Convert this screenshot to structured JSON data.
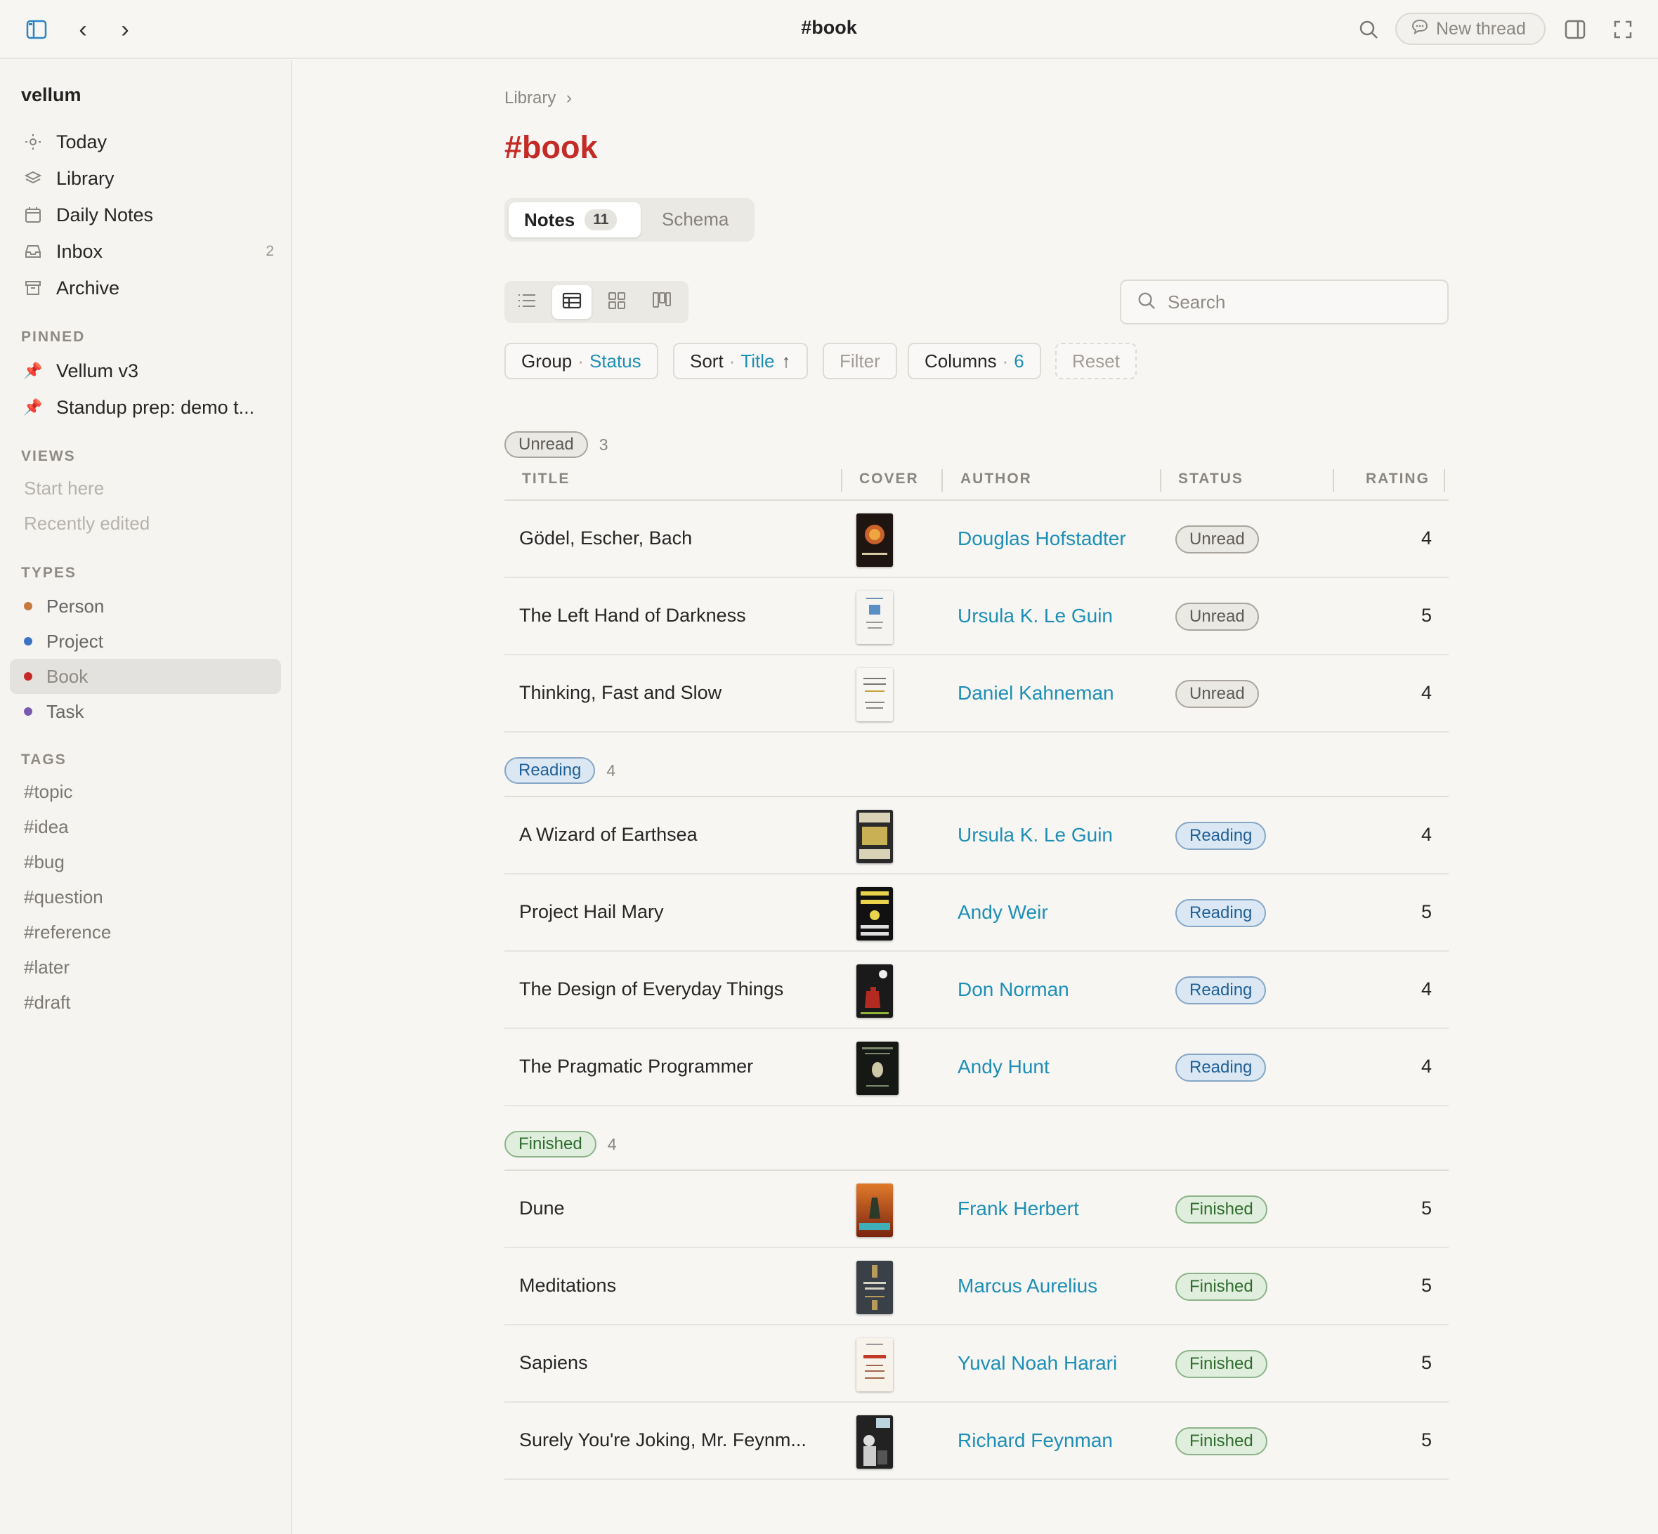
{
  "topbar": {
    "title": "#book",
    "new_thread_label": "New thread"
  },
  "sidebar": {
    "workspace": "vellum",
    "nav": [
      {
        "label": "Today",
        "icon": "sun-icon",
        "count": ""
      },
      {
        "label": "Library",
        "icon": "layers-icon",
        "count": ""
      },
      {
        "label": "Daily Notes",
        "icon": "calendar-icon",
        "count": ""
      },
      {
        "label": "Inbox",
        "icon": "inbox-icon",
        "count": "2"
      },
      {
        "label": "Archive",
        "icon": "archive-icon",
        "count": ""
      }
    ],
    "pinned_label": "PINNED",
    "pinned": [
      {
        "label": "Vellum v3"
      },
      {
        "label": "Standup prep: demo t..."
      }
    ],
    "views_label": "VIEWS",
    "views": [
      {
        "label": "Start here"
      },
      {
        "label": "Recently edited"
      }
    ],
    "types_label": "TYPES",
    "types": [
      {
        "label": "Person",
        "color": "#c87a3e"
      },
      {
        "label": "Project",
        "color": "#3a72c4"
      },
      {
        "label": "Book",
        "color": "#c42b27"
      },
      {
        "label": "Task",
        "color": "#7a5ab0"
      }
    ],
    "tags_label": "TAGS",
    "tags": [
      {
        "label": "#topic"
      },
      {
        "label": "#idea"
      },
      {
        "label": "#bug"
      },
      {
        "label": "#question"
      },
      {
        "label": "#reference"
      },
      {
        "label": "#later"
      },
      {
        "label": "#draft"
      }
    ]
  },
  "main": {
    "breadcrumb": "Library",
    "title": "#book",
    "tabs": {
      "notes_label": "Notes",
      "notes_count": "11",
      "schema_label": "Schema"
    },
    "search_placeholder": "Search",
    "toolbar": {
      "group_label": "Group",
      "group_value": "Status",
      "sort_label": "Sort",
      "sort_value": "Title",
      "sort_arrow": "↑",
      "filter_label": "Filter",
      "columns_label": "Columns",
      "columns_value": "6",
      "reset_label": "Reset"
    },
    "columns": [
      "TITLE",
      "COVER",
      "AUTHOR",
      "STATUS",
      "RATING"
    ],
    "groups": [
      {
        "name": "Unread",
        "count": "3",
        "rows": [
          {
            "title": "Gödel, Escher, Bach",
            "author": "Douglas Hofstadter",
            "status": "Unread",
            "rating": "4"
          },
          {
            "title": "The Left Hand of Darkness",
            "author": "Ursula K. Le Guin",
            "status": "Unread",
            "rating": "5"
          },
          {
            "title": "Thinking, Fast and Slow",
            "author": "Daniel Kahneman",
            "status": "Unread",
            "rating": "4"
          }
        ]
      },
      {
        "name": "Reading",
        "count": "4",
        "rows": [
          {
            "title": "A Wizard of Earthsea",
            "author": "Ursula K. Le Guin",
            "status": "Reading",
            "rating": "4"
          },
          {
            "title": "Project Hail Mary",
            "author": "Andy Weir",
            "status": "Reading",
            "rating": "5"
          },
          {
            "title": "The Design of Everyday Things",
            "author": "Don Norman",
            "status": "Reading",
            "rating": "4"
          },
          {
            "title": "The Pragmatic Programmer",
            "author": "Andy Hunt",
            "status": "Reading",
            "rating": "4"
          }
        ]
      },
      {
        "name": "Finished",
        "count": "4",
        "rows": [
          {
            "title": "Dune",
            "author": "Frank Herbert",
            "status": "Finished",
            "rating": "5"
          },
          {
            "title": "Meditations",
            "author": "Marcus Aurelius",
            "status": "Finished",
            "rating": "5"
          },
          {
            "title": "Sapiens",
            "author": "Yuval Noah Harari",
            "status": "Finished",
            "rating": "5"
          },
          {
            "title": "Surely You're Joking, Mr. Feynm...",
            "author": "Richard Feynman",
            "status": "Finished",
            "rating": "5"
          }
        ]
      }
    ]
  },
  "colors": {
    "accent_red": "#c42b27",
    "link_blue": "#1d8fb6",
    "unread": "#5e5b56",
    "reading": "#1f5f97",
    "finished": "#2d6c2c"
  }
}
